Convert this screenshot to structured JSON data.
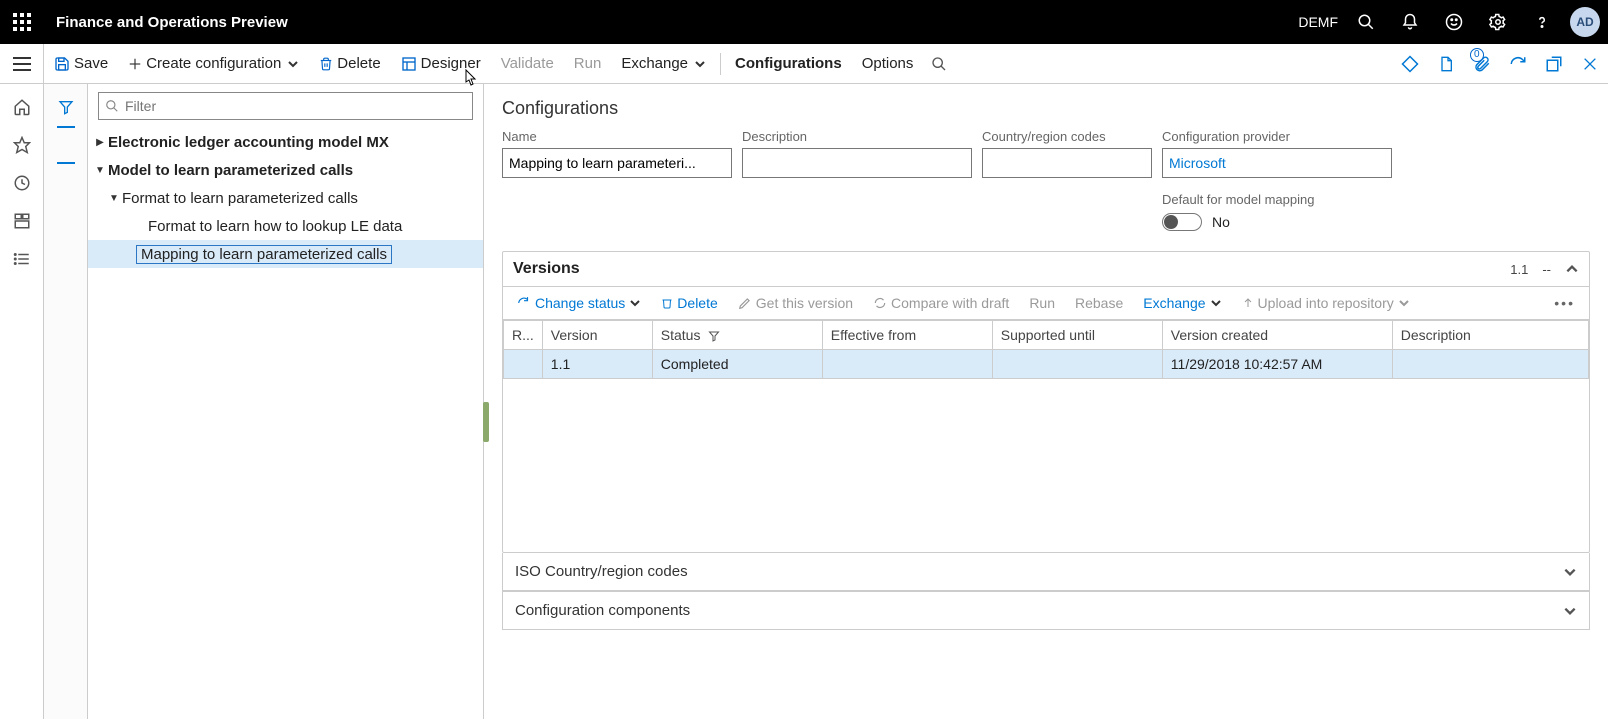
{
  "header": {
    "app_title": "Finance and Operations Preview",
    "env": "DEMF",
    "avatar_initials": "AD"
  },
  "actions": {
    "save": "Save",
    "create_config": "Create configuration",
    "delete": "Delete",
    "designer": "Designer",
    "validate": "Validate",
    "run": "Run",
    "exchange": "Exchange",
    "configurations": "Configurations",
    "options": "Options",
    "attachments_badge": "0"
  },
  "tree": {
    "filter_placeholder": "Filter",
    "nodes": {
      "n0": {
        "label": "Electronic ledger accounting model MX"
      },
      "n1": {
        "label": "Model to learn parameterized calls"
      },
      "n2": {
        "label": "Format to learn parameterized calls"
      },
      "n3": {
        "label": "Format to learn how to lookup LE data"
      },
      "n4": {
        "label": "Mapping to learn parameterized calls"
      }
    }
  },
  "config": {
    "section_title": "Configurations",
    "labels": {
      "name": "Name",
      "description": "Description",
      "codes": "Country/region codes",
      "provider": "Configuration provider",
      "default": "Default for model mapping"
    },
    "values": {
      "name": "Mapping to learn parameteri...",
      "description": "",
      "codes": "",
      "provider": "Microsoft",
      "default_text": "No"
    }
  },
  "versions": {
    "title": "Versions",
    "summary_version": "1.1",
    "summary_more": "--",
    "toolbar": {
      "change_status": "Change status",
      "delete": "Delete",
      "get_version": "Get this version",
      "compare": "Compare with draft",
      "run": "Run",
      "rebase": "Rebase",
      "exchange": "Exchange",
      "upload": "Upload into repository"
    },
    "columns": {
      "rev": "R...",
      "version": "Version",
      "status": "Status",
      "effective": "Effective from",
      "supported": "Supported until",
      "created": "Version created",
      "description": "Description"
    },
    "rows": [
      {
        "version": "1.1",
        "status": "Completed",
        "effective": "",
        "supported": "",
        "created": "11/29/2018 10:42:57 AM",
        "description": ""
      }
    ]
  },
  "collapsed_sections": {
    "iso": "ISO Country/region codes",
    "components": "Configuration components"
  }
}
